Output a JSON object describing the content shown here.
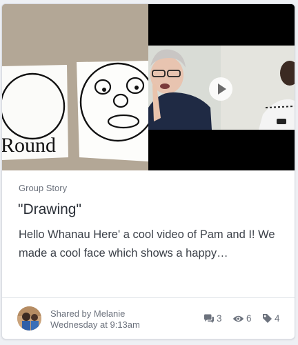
{
  "card": {
    "category": "Group Story",
    "title": "\"Drawing\"",
    "excerpt": "Hello Whanau Here' a cool video of Pam and I! We made a cool face which shows a happy…",
    "author": "Shared by Melanie",
    "time": "Wednesday at 9:13am",
    "stats": {
      "comments": "3",
      "views": "6",
      "tags": "4"
    }
  },
  "media": {
    "photo_text": "Round",
    "play_icon": "play-icon"
  },
  "colors": {
    "video_background": "#000000",
    "paper": "#ffffff",
    "table": "#b9ad9c",
    "muted_text": "#6c727d",
    "title_text": "#2a2f37"
  }
}
